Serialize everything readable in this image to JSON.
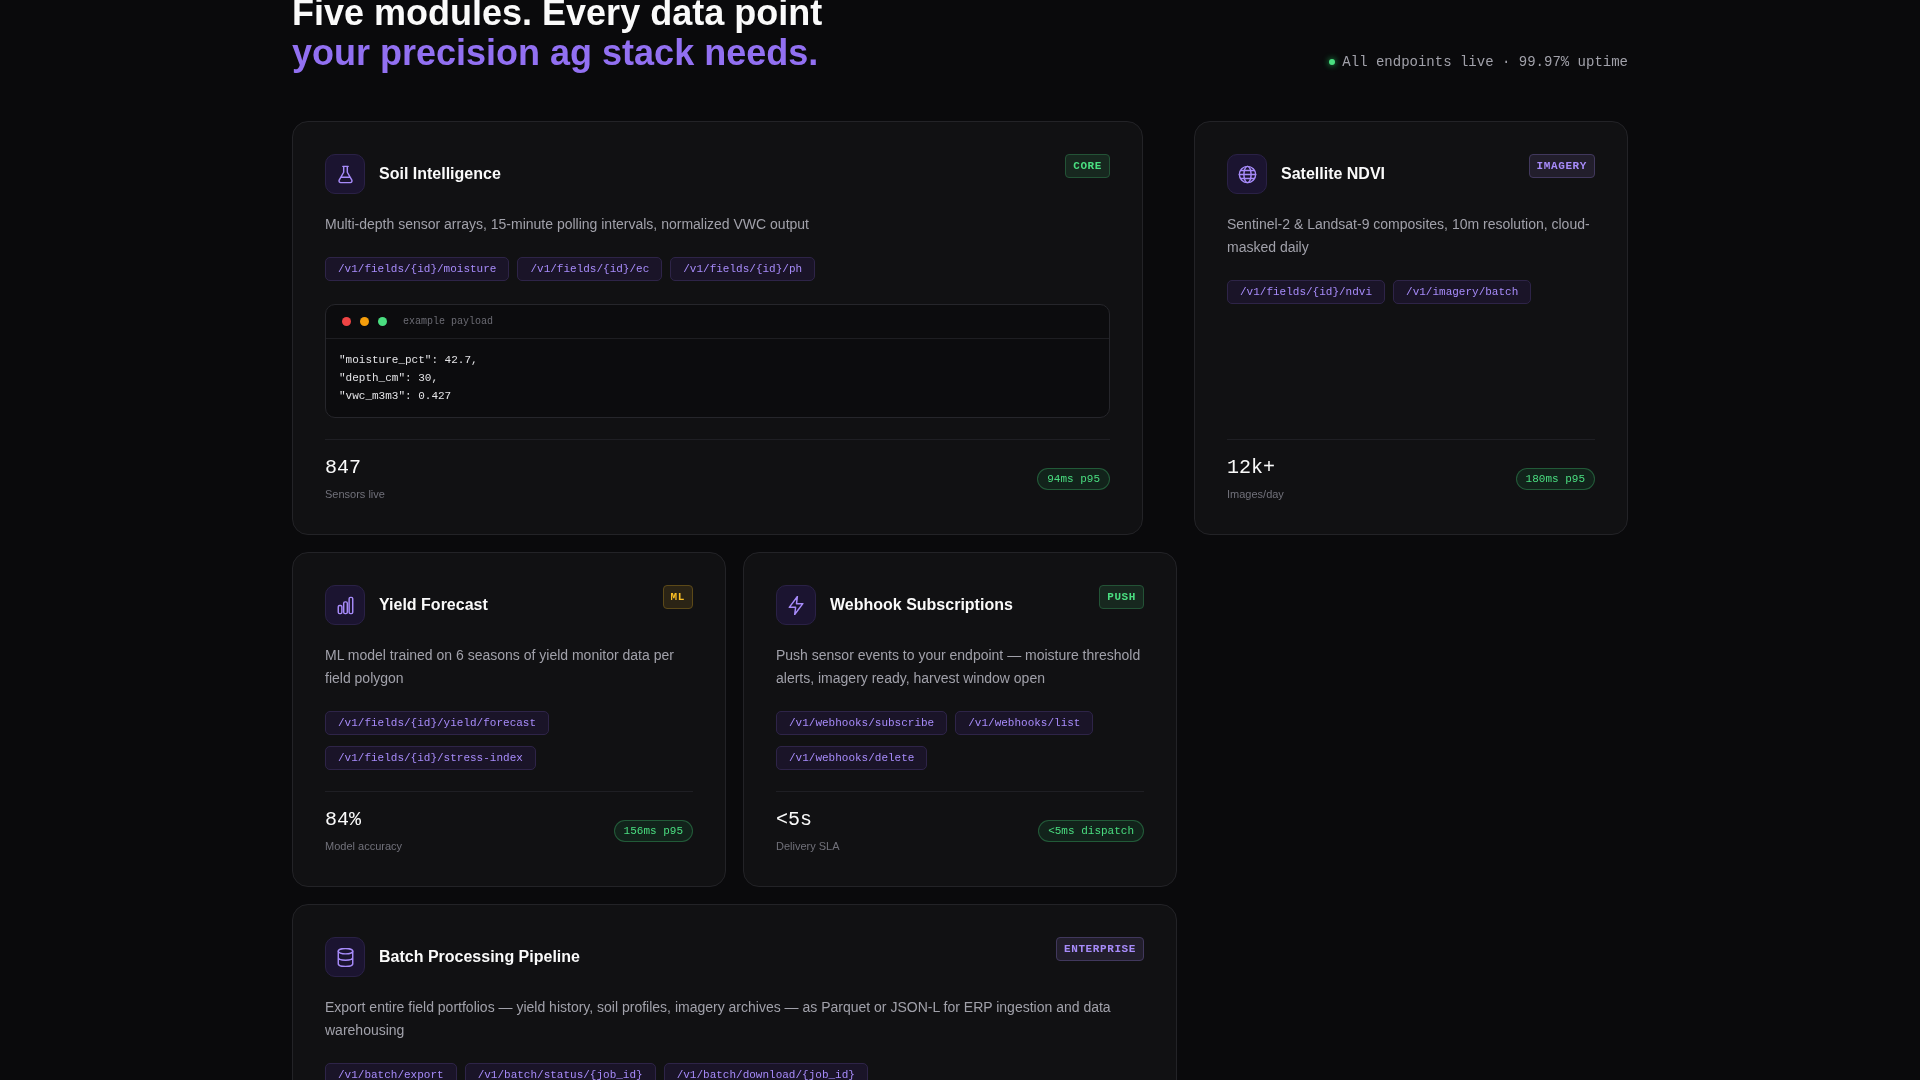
{
  "header": {
    "title": "Five modules. Every data point",
    "highlight": "your precision ag stack needs.",
    "status": "All endpoints live · 99.97% uptime"
  },
  "modules": [
    {
      "title": "Soil Intelligence",
      "badge": {
        "label": "CORE",
        "color": "#4ade80"
      },
      "description": "Multi-depth sensor arrays, 15-minute polling intervals, normalized VWC output",
      "endpoints": [
        "/v1/fields/{id}/moisture",
        "/v1/fields/{id}/ec",
        "/v1/fields/{id}/ph"
      ],
      "payload": {
        "label": "example payload",
        "lines": [
          "\"moisture_pct\": 42.7,",
          "\"depth_cm\": 30,",
          "\"vwc_m3m3\": 0.427"
        ]
      },
      "stat": {
        "value": "847",
        "label": "Sensors live",
        "latency": "94ms p95"
      }
    },
    {
      "title": "Satellite NDVI",
      "badge": {
        "label": "IMAGERY",
        "color": "#a78bfa"
      },
      "description": "Sentinel-2 & Landsat-9 composites, 10m resolution, cloud-masked daily",
      "endpoints": [
        "/v1/fields/{id}/ndvi",
        "/v1/imagery/batch"
      ],
      "stat": {
        "value": "12k+",
        "label": "Images/day",
        "latency": "180ms p95"
      }
    },
    {
      "title": "Yield Forecast",
      "badge": {
        "label": "ML",
        "color": "#fbbf24"
      },
      "description": "ML model trained on 6 seasons of yield monitor data per field polygon",
      "endpoints": [
        "/v1/fields/{id}/yield/forecast",
        "/v1/fields/{id}/stress-index"
      ],
      "stat": {
        "value": "84%",
        "label": "Model accuracy",
        "latency": "156ms p95"
      }
    },
    {
      "title": "Webhook Subscriptions",
      "badge": {
        "label": "PUSH",
        "color": "#4ade80"
      },
      "description": "Push sensor events to your endpoint — moisture threshold alerts, imagery ready, harvest window open",
      "endpoints": [
        "/v1/webhooks/subscribe",
        "/v1/webhooks/list",
        "/v1/webhooks/delete"
      ],
      "stat": {
        "value": "<5s",
        "label": "Delivery SLA",
        "latency": "<5ms dispatch"
      }
    },
    {
      "title": "Batch Processing Pipeline",
      "badge": {
        "label": "ENTERPRISE",
        "color": "#a78bfa"
      },
      "description": "Export entire field portfolios — yield history, soil profiles, imagery archives — as Parquet or JSON-L for ERP ingestion and data warehousing",
      "endpoints": [
        "/v1/batch/export",
        "/v1/batch/status/{job_id}",
        "/v1/batch/download/{job_id}"
      ]
    }
  ]
}
